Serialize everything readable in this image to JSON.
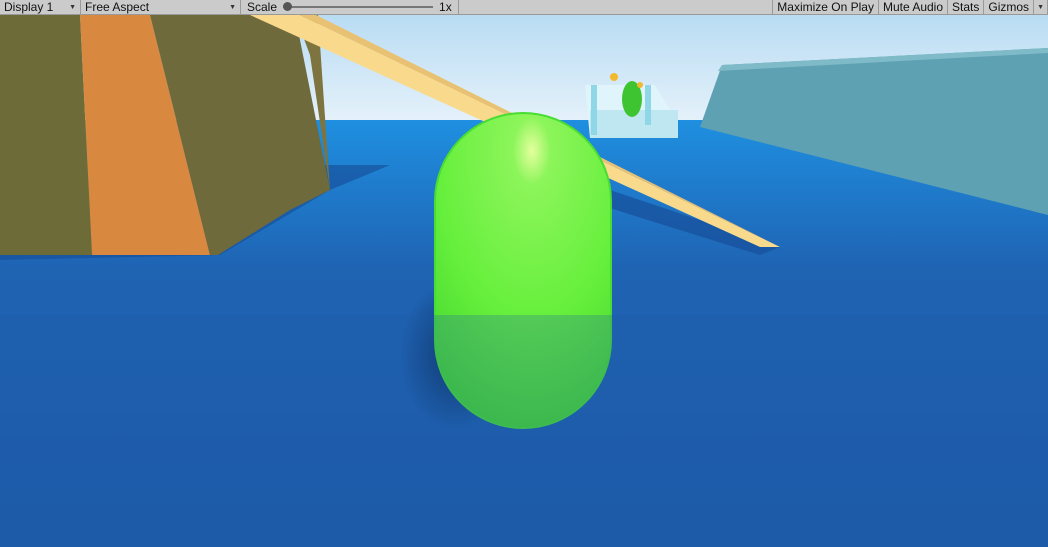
{
  "toolbar": {
    "display": "Display 1",
    "aspect": "Free Aspect",
    "scale_label": "Scale",
    "scale_value": "1x",
    "scale_fraction": 0.0,
    "maximize": "Maximize On Play",
    "mute": "Mute Audio",
    "stats": "Stats",
    "gizmos": "Gizmos"
  },
  "scene": {
    "sky_color": "#cfe6f5",
    "ground_color": "#1f5dab",
    "player_color": "#6cf03f",
    "ramp_color": "#d8893f",
    "wall_color": "#5ca0b0",
    "beam_color": "#f9da8c"
  }
}
